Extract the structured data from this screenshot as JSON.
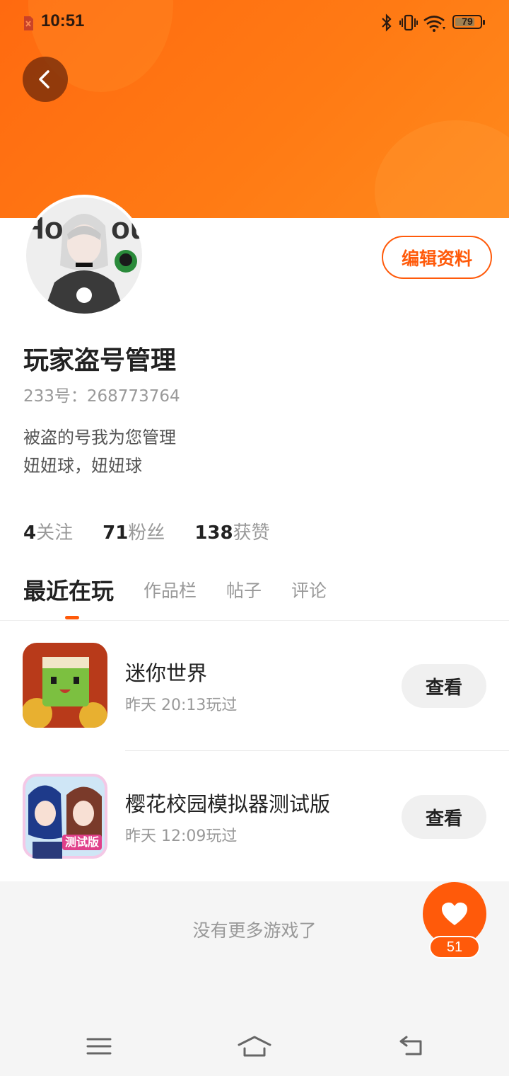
{
  "status_bar": {
    "time": "10:51",
    "battery": "79",
    "icons": [
      "sim-off-icon",
      "bluetooth-icon",
      "vibrate-icon",
      "wifi-icon",
      "battery-icon"
    ]
  },
  "header": {
    "back_icon": "chevron-left-icon",
    "accent_color": "#ff5a0a"
  },
  "profile": {
    "edit_label": "编辑资料",
    "nickname": "玩家盗号管理",
    "id_label": "233号：268773764",
    "bio_line1": "被盗的号我为您管理",
    "bio_line2": "妞妞球，妞妞球",
    "stats": [
      {
        "value": "4",
        "label": "关注"
      },
      {
        "value": "71",
        "label": "粉丝"
      },
      {
        "value": "138",
        "label": "获赞"
      }
    ]
  },
  "tabs": [
    {
      "label": "最近在玩",
      "active": true
    },
    {
      "label": "作品栏",
      "active": false
    },
    {
      "label": "帖子",
      "active": false
    },
    {
      "label": "评论",
      "active": false
    }
  ],
  "games": [
    {
      "title": "迷你世界",
      "played": "昨天 20:13玩过",
      "button": "查看"
    },
    {
      "title": "樱花校园模拟器测试版",
      "played": "昨天 12:09玩过",
      "button": "查看",
      "badge": "测试版"
    }
  ],
  "footer": {
    "no_more": "没有更多游戏了",
    "like_count": "51",
    "like_icon": "heart-icon"
  },
  "nav": {
    "icons": [
      "menu-icon",
      "home-icon",
      "back-nav-icon"
    ]
  }
}
